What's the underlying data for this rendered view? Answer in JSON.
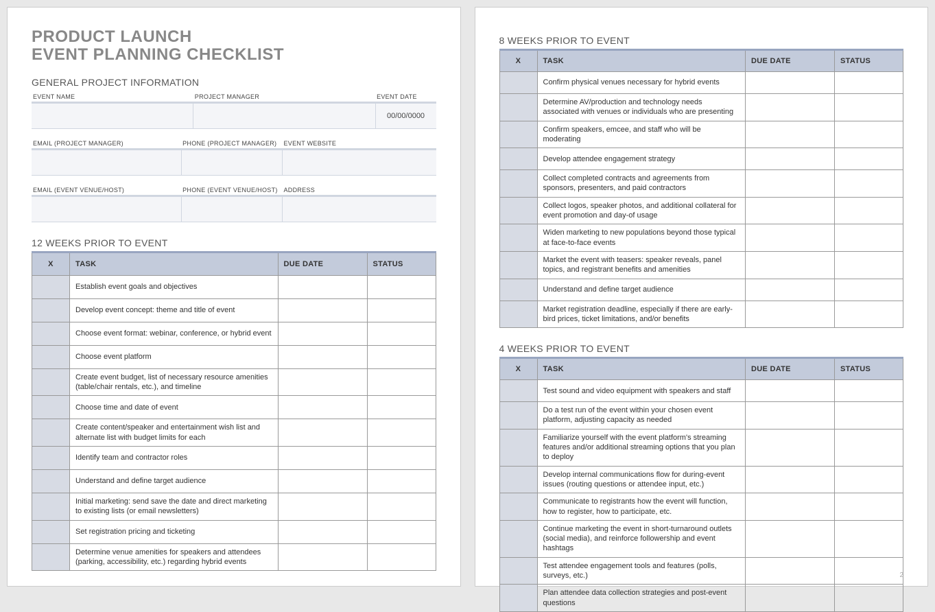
{
  "title_line1": "PRODUCT LAUNCH",
  "title_line2": "EVENT PLANNING CHECKLIST",
  "general_heading": "GENERAL PROJECT INFORMATION",
  "info1": {
    "h1": "EVENT NAME",
    "h2": "PROJECT MANAGER",
    "h3": "EVENT DATE",
    "v1": "",
    "v2": "",
    "v3": "00/00/0000"
  },
  "info2": {
    "h1": "EMAIL (PROJECT MANAGER)",
    "h2": "PHONE (PROJECT MANAGER)",
    "h3": "EVENT WEBSITE",
    "v1": "",
    "v2": "",
    "v3": ""
  },
  "info3": {
    "h1": "EMAIL (EVENT VENUE/HOST)",
    "h2": "PHONE (EVENT VENUE/HOST)",
    "h3": "ADDRESS",
    "v1": "",
    "v2": "",
    "v3": ""
  },
  "cols": {
    "x": "X",
    "task": "TASK",
    "due": "DUE DATE",
    "status": "STATUS"
  },
  "w12_title": "12 WEEKS PRIOR TO EVENT",
  "w12": [
    "Establish event goals and objectives",
    "Develop event concept: theme and title of event",
    "Choose event format: webinar, conference, or hybrid event",
    "Choose event platform",
    "Create event budget, list of necessary resource amenities (table/chair rentals, etc.), and timeline",
    "Choose time and date of event",
    "Create content/speaker and entertainment wish list and alternate list with budget limits for each",
    "Identify team and contractor roles",
    "Understand and define target audience",
    "Initial marketing: send save the date and direct marketing to existing lists (or email newsletters)",
    "Set registration pricing and ticketing",
    "Determine venue amenities for speakers and attendees (parking, accessibility, etc.) regarding hybrid events"
  ],
  "w8_title": "8 WEEKS PRIOR TO EVENT",
  "w8": [
    "Confirm physical venues necessary for hybrid events",
    "Determine AV/production and technology needs associated with venues or individuals who are presenting",
    "Confirm speakers, emcee, and staff who will be moderating",
    "Develop attendee engagement strategy",
    "Collect completed contracts and agreements from sponsors, presenters, and paid contractors",
    "Collect logos, speaker photos, and additional collateral for event promotion and day-of usage",
    "Widen marketing to new populations beyond those typical at face-to-face events",
    "Market the event with teasers: speaker reveals, panel topics, and registrant benefits and amenities",
    "Understand and define target audience",
    "Market registration deadline, especially if there are early-bird prices, ticket limitations, and/or benefits"
  ],
  "w4_title": "4 WEEKS PRIOR TO EVENT",
  "w4": [
    "Test sound and video equipment with speakers and staff",
    "Do a test run of the event within your chosen event platform, adjusting capacity as needed",
    "Familiarize yourself with the event platform's streaming features and/or additional streaming options that you plan to deploy",
    "Develop internal communications flow for during-event issues (routing questions or attendee input, etc.)",
    "Communicate to registrants how the event will function, how to register, how to participate, etc.",
    "Continue marketing the event in short-turnaround outlets (social media), and reinforce followership and event hashtags",
    "Test attendee engagement tools and features (polls, surveys, etc.)",
    "Plan attendee data collection strategies and post-event questions"
  ],
  "page_number": "2"
}
